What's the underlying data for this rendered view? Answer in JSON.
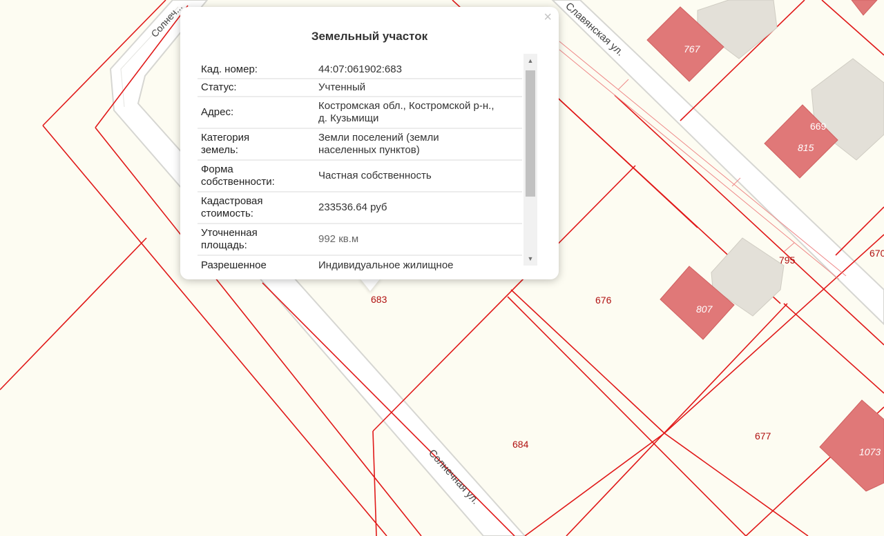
{
  "map": {
    "colors": {
      "background": "#fdfcf2",
      "boundary": "#e01818",
      "building_fill": "#e07878",
      "building_3d": "#e3e0d8",
      "road": "#ffffff",
      "road_edge": "#d6d6d2",
      "parcel_label": "#b01010"
    },
    "streets": {
      "solnechnaya_top": "Солнеч...",
      "solnechnaya": "Солнечная ул.",
      "slavyanskaya": "Славянская ул."
    },
    "parcel_labels": {
      "p683": "683",
      "p676": "676",
      "p684": "684",
      "p677": "677",
      "p795": "795",
      "p669": "669",
      "p670": "670"
    },
    "building_labels": {
      "b767": "767",
      "b815": "815",
      "b807": "807",
      "b1073": "1073"
    }
  },
  "popup": {
    "title": "Земельный участок",
    "close_icon": "close-icon",
    "rows": [
      {
        "key": "Кад. номер:",
        "value": "44:07:061902:683"
      },
      {
        "key": "Статус:",
        "value": "Учтенный"
      },
      {
        "key": "Адрес:",
        "value_line1": "Костромская обл., Костромской р-н.,",
        "value_line2": "д. Кузьмищи"
      },
      {
        "key_line1": "Категория",
        "key_line2": "земель:",
        "value_line1": "Земли поселений (земли",
        "value_line2": "населенных пунктов)"
      },
      {
        "key_line1": "Форма",
        "key_line2": "собственности:",
        "value": "Частная собственность"
      },
      {
        "key_line1": "Кадастровая",
        "key_line2": "стоимость:",
        "value": "233536.64 руб"
      },
      {
        "key_line1": "Уточненная",
        "key_line2": "площадь:",
        "value": "992 кв.м"
      },
      {
        "key": "Разрешенное",
        "value": "Индивидуальное жилищное"
      }
    ]
  }
}
